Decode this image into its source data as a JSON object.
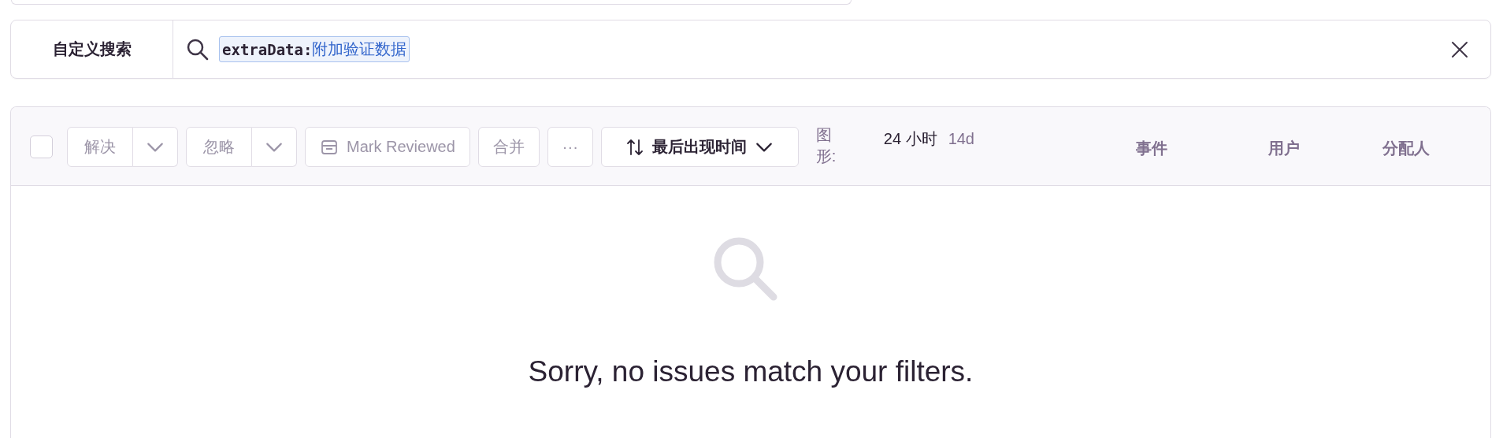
{
  "search": {
    "label": "自定义搜索",
    "token_key": "extraData:",
    "token_value": "附加验证数据"
  },
  "toolbar": {
    "select_all": {
      "checked": false
    },
    "actions": [
      {
        "kind": "split",
        "label": "解决",
        "disabled": true
      },
      {
        "kind": "split",
        "label": "忽略",
        "disabled": true
      },
      {
        "kind": "review",
        "label": "Mark Reviewed",
        "disabled": true
      },
      {
        "kind": "plain",
        "label": "合并",
        "disabled": true
      },
      {
        "kind": "plain",
        "label": "···",
        "disabled": true
      }
    ],
    "sort": {
      "label": "最后出现时间"
    },
    "graph_label": "图形:",
    "periods": [
      {
        "label": "24 小时",
        "selected": true
      },
      {
        "label": "14d",
        "selected": false
      }
    ],
    "columns": [
      "事件",
      "用户",
      "分配人"
    ]
  },
  "empty_state": {
    "message": "Sorry, no issues match your filters."
  }
}
